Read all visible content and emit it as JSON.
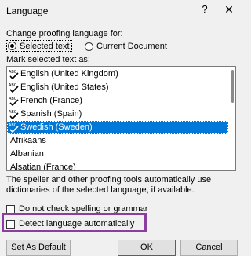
{
  "dialog": {
    "title": "Language",
    "help_symbol": "?",
    "close_symbol": "✕"
  },
  "change_section": {
    "label": "Change proofing language for:",
    "options": [
      {
        "label": "Selected text",
        "checked": true
      },
      {
        "label": "Current Document",
        "checked": false
      }
    ]
  },
  "mark_label": "Mark selected text as:",
  "languages": [
    {
      "label": "English (United Kingdom)",
      "spell_icon": true,
      "selected": false
    },
    {
      "label": "English (United States)",
      "spell_icon": true,
      "selected": false
    },
    {
      "label": "French (France)",
      "spell_icon": true,
      "selected": false
    },
    {
      "label": "Spanish (Spain)",
      "spell_icon": true,
      "selected": false
    },
    {
      "label": "Swedish (Sweden)",
      "spell_icon": true,
      "selected": true
    },
    {
      "label": "Afrikaans",
      "spell_icon": false,
      "selected": false
    },
    {
      "label": "Albanian",
      "spell_icon": false,
      "selected": false
    },
    {
      "label": "Alsatian (France)",
      "spell_icon": false,
      "selected": false
    }
  ],
  "note": "The speller and other proofing tools automatically use dictionaries of the selected language, if available.",
  "checkboxes": {
    "do_not_check": "Do not check spelling or grammar",
    "detect_language": "Detect language automatically"
  },
  "buttons": {
    "set_default": "Set As Default",
    "ok": "OK",
    "cancel": "Cancel"
  },
  "colors": {
    "selection": "#0078d7",
    "highlight": "#8a3fa0",
    "background": "#f0f0f0"
  }
}
